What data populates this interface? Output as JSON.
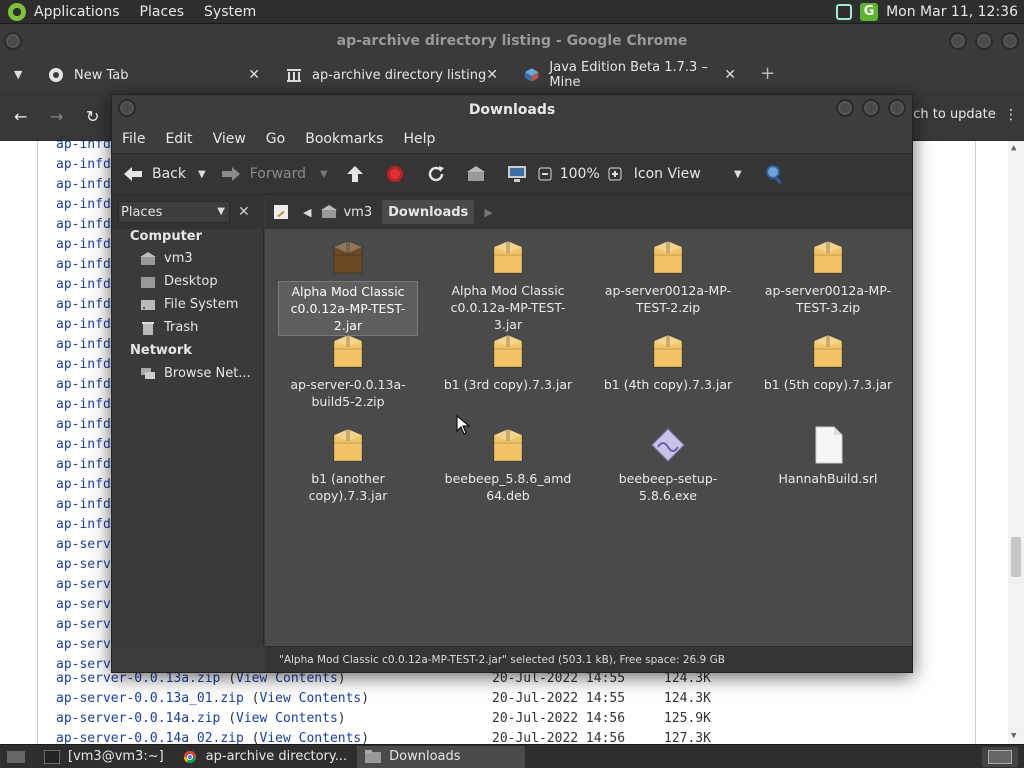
{
  "top_panel": {
    "menus": [
      "Applications",
      "Places",
      "System"
    ],
    "clock": "Mon Mar 11, 12:36",
    "app_letter": "G"
  },
  "chrome": {
    "window_title": "ap-archive directory listing - Google Chrome",
    "tabs": [
      {
        "label": "New Tab"
      },
      {
        "label": "ap-archive directory listing"
      },
      {
        "label": "Java Edition Beta 1.7.3 – Mine"
      }
    ],
    "update_label": "nch to update",
    "page_rows": [
      {
        "link": "ap-infd",
        "rest": ""
      },
      {
        "link": "ap-infd",
        "rest": ""
      },
      {
        "link": "ap-infd",
        "rest": ""
      },
      {
        "link": "ap-infd",
        "rest": ""
      },
      {
        "link": "ap-infd",
        "rest": ""
      },
      {
        "link": "ap-infd",
        "rest": ""
      },
      {
        "link": "ap-infd",
        "rest": ""
      },
      {
        "link": "ap-infd",
        "rest": ""
      },
      {
        "link": "ap-infd",
        "rest": ""
      },
      {
        "link": "ap-infd",
        "rest": ""
      },
      {
        "link": "ap-infd",
        "rest": ""
      },
      {
        "link": "ap-infd",
        "rest": ""
      },
      {
        "link": "ap-infd",
        "rest": ""
      },
      {
        "link": "ap-infd",
        "rest": ""
      },
      {
        "link": "ap-infd",
        "rest": ""
      },
      {
        "link": "ap-infd",
        "rest": ""
      },
      {
        "link": "ap-infd",
        "rest": ""
      },
      {
        "link": "ap-infd",
        "rest": ""
      },
      {
        "link": "ap-infd",
        "rest": ""
      },
      {
        "link": "ap-infd",
        "rest": ""
      },
      {
        "link": "ap-serv",
        "rest": ""
      },
      {
        "link": "ap-serv",
        "rest": ""
      },
      {
        "link": "ap-serv",
        "rest": ""
      },
      {
        "link": "ap-serv",
        "rest": ""
      },
      {
        "link": "ap-serv",
        "rest": ""
      },
      {
        "link": "ap-serv",
        "rest": ""
      },
      {
        "link": "ap-serv",
        "rest": ""
      }
    ],
    "full_rows": [
      {
        "file": "ap-server-0.0.13a.zip",
        "view": "View Contents",
        "date": "20-Jul-2022 14:55",
        "size": "124.3K"
      },
      {
        "file": "ap-server-0.0.13a_01.zip",
        "view": "View Contents",
        "date": "20-Jul-2022 14:55",
        "size": "124.3K"
      },
      {
        "file": "ap-server-0.0.14a.zip",
        "view": "View Contents",
        "date": "20-Jul-2022 14:56",
        "size": "125.9K"
      },
      {
        "file": "ap-server-0.0.14a_02.zip",
        "view": "View Contents",
        "date": "20-Jul-2022 14:56",
        "size": "127.3K"
      }
    ]
  },
  "fm": {
    "title": "Downloads",
    "menus": [
      "File",
      "Edit",
      "View",
      "Go",
      "Bookmarks",
      "Help"
    ],
    "toolbar": {
      "back": "Back",
      "forward": "Forward",
      "zoom": "100%",
      "view_mode": "Icon View"
    },
    "places_label": "Places",
    "sidebar": {
      "computer_head": "Computer",
      "computer_items": [
        "vm3",
        "Desktop",
        "File System",
        "Trash"
      ],
      "network_head": "Network",
      "network_items": [
        "Browse Net..."
      ]
    },
    "path": [
      "vm3",
      "Downloads"
    ],
    "files": [
      {
        "name": "Alpha Mod Classic c0.0.12a-MP-TEST-2.jar",
        "kind": "jar-selected",
        "selected": true
      },
      {
        "name": "Alpha Mod Classic c0.0.12a-MP-TEST-3.jar",
        "kind": "package"
      },
      {
        "name": "ap-server0012a-MP-TEST-2.zip",
        "kind": "package"
      },
      {
        "name": "ap-server0012a-MP-TEST-3.zip",
        "kind": "package"
      },
      {
        "name": "ap-server-0.0.13a-build5-2.zip",
        "kind": "package"
      },
      {
        "name": "b1 (3rd copy).7.3.jar",
        "kind": "package"
      },
      {
        "name": "b1 (4th copy).7.3.jar",
        "kind": "package"
      },
      {
        "name": "b1 (5th copy).7.3.jar",
        "kind": "package"
      },
      {
        "name": "b1 (another copy).7.3.jar",
        "kind": "package"
      },
      {
        "name": "beebeep_5.8.6_amd64.deb",
        "kind": "package"
      },
      {
        "name": "beebeep-setup-5.8.6.exe",
        "kind": "exe"
      },
      {
        "name": "HannahBuild.srl",
        "kind": "blank"
      }
    ],
    "status": "\"Alpha Mod Classic c0.0.12a-MP-TEST-2.jar\" selected (503.1 kB), Free space: 26.9 GB"
  },
  "taskbar": {
    "items": [
      "[vm3@vm3:~]",
      "ap-archive directory...",
      "Downloads"
    ]
  },
  "colors": {
    "link": "#1a3ea8",
    "folder": "#f2c467",
    "selected_jar": "#6b4a24",
    "accent_green": "#7ec23a"
  }
}
